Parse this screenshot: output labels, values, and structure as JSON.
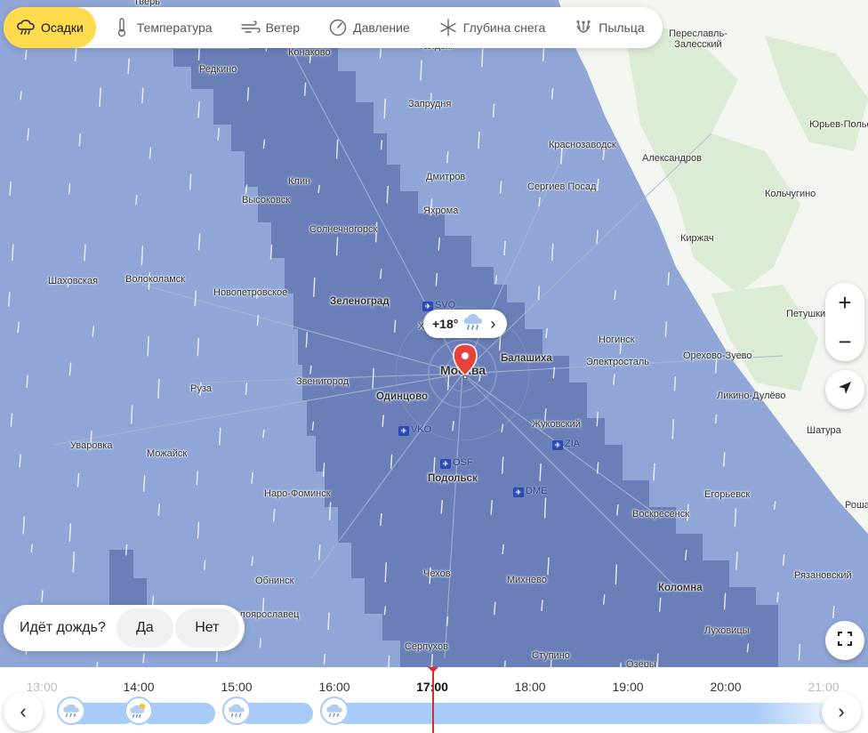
{
  "layers": [
    {
      "label": "Осадки",
      "icon": "precipitation-icon",
      "active": true
    },
    {
      "label": "Температура",
      "icon": "thermometer-icon",
      "active": false
    },
    {
      "label": "Ветер",
      "icon": "wind-icon",
      "active": false
    },
    {
      "label": "Давление",
      "icon": "pressure-icon",
      "active": false
    },
    {
      "label": "Глубина снега",
      "icon": "snowflake-icon",
      "active": false
    },
    {
      "label": "Пыльца",
      "icon": "pollen-icon",
      "active": false
    }
  ],
  "cities": [
    {
      "name": "Тверь"
    },
    {
      "name": "Конаково"
    },
    {
      "name": "Редкино"
    },
    {
      "name": "Талдом"
    },
    {
      "name": "Запрудня"
    },
    {
      "name": "Переславль-Залесский"
    },
    {
      "name": "Юрьев-Польский"
    },
    {
      "name": "Краснозаводск"
    },
    {
      "name": "Александров"
    },
    {
      "name": "Клин"
    },
    {
      "name": "Высоковск"
    },
    {
      "name": "Дмитров"
    },
    {
      "name": "Сергиев Посад"
    },
    {
      "name": "Кольчугино"
    },
    {
      "name": "Яхрома"
    },
    {
      "name": "Солнечногорск"
    },
    {
      "name": "Киржач"
    },
    {
      "name": "Шаховская"
    },
    {
      "name": "Волоколамск"
    },
    {
      "name": "Новопетровское"
    },
    {
      "name": "Зеленоград"
    },
    {
      "name": "Петушки"
    },
    {
      "name": "Ногинск"
    },
    {
      "name": "Балашиха"
    },
    {
      "name": "Электросталь"
    },
    {
      "name": "Орехово-Зуево"
    },
    {
      "name": "Москва"
    },
    {
      "name": "Звенигород"
    },
    {
      "name": "Руза"
    },
    {
      "name": "Одинцово"
    },
    {
      "name": "Ликино-Дулёво"
    },
    {
      "name": "Жуковский"
    },
    {
      "name": "Уваровка"
    },
    {
      "name": "Можайск"
    },
    {
      "name": "Шатура"
    },
    {
      "name": "Подольск"
    },
    {
      "name": "Наро-Фоминск"
    },
    {
      "name": "Егорьевск"
    },
    {
      "name": "Воскресенск"
    },
    {
      "name": "Обнинск"
    },
    {
      "name": "Чехов"
    },
    {
      "name": "Михнево"
    },
    {
      "name": "Рязановский"
    },
    {
      "name": "Коломна"
    },
    {
      "name": "Малоярославец"
    },
    {
      "name": "Серпухов"
    },
    {
      "name": "Луховицы"
    },
    {
      "name": "Ступино"
    },
    {
      "name": "Озёры"
    },
    {
      "name": "Химки"
    },
    {
      "name": "Рошаль"
    }
  ],
  "airports": [
    {
      "code": "SVO"
    },
    {
      "code": "VKO"
    },
    {
      "code": "ZIA"
    },
    {
      "code": "OSF"
    },
    {
      "code": "DME"
    }
  ],
  "bubble": {
    "temp": "+18°",
    "icon": "rain-cloud-icon"
  },
  "zoom": {
    "plus": "+",
    "minus": "−"
  },
  "rain_question": {
    "text": "Идёт дождь?",
    "yes": "Да",
    "no": "Нет"
  },
  "timeline": {
    "hours": [
      {
        "label": "13:00",
        "state": "faded"
      },
      {
        "label": "14:00",
        "state": "normal"
      },
      {
        "label": "15:00",
        "state": "normal"
      },
      {
        "label": "16:00",
        "state": "normal"
      },
      {
        "label": "17:00",
        "state": "now"
      },
      {
        "label": "18:00",
        "state": "normal"
      },
      {
        "label": "19:00",
        "state": "normal"
      },
      {
        "label": "20:00",
        "state": "normal"
      },
      {
        "label": "21:00",
        "state": "faded"
      }
    ],
    "hour_icons": [
      "rain-cloud-icon",
      "sun-rain-cloud-icon",
      "rain-cloud-icon",
      "rain-cloud-icon"
    ],
    "prev": "‹",
    "next": "›"
  },
  "colors": {
    "precip_light": "#8fa6d6",
    "precip_heavy": "#6a7fb7",
    "land": "#f3f5f0",
    "accent": "#ffdb4d",
    "marker": "#e8413a",
    "timeline_bar": "#a9cbf7"
  }
}
